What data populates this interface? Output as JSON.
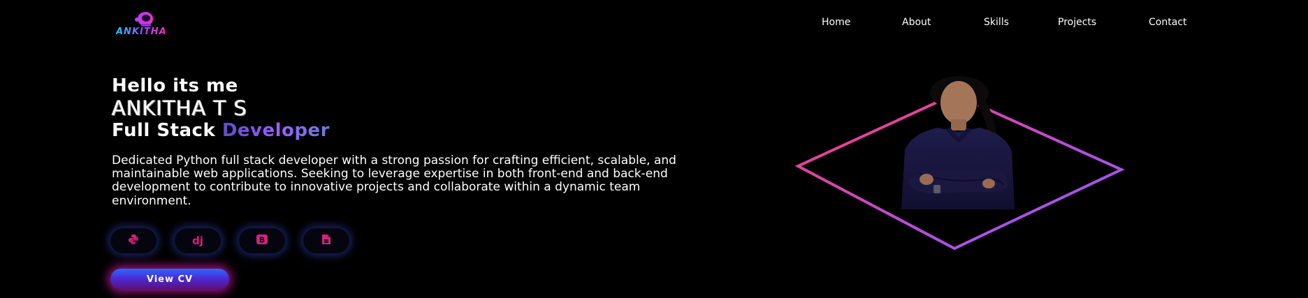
{
  "brand": {
    "name": "ANKITHA",
    "logo_icon": "astronaut-helmet-icon"
  },
  "nav": {
    "items": [
      "Home",
      "About",
      "Skills",
      "Projects",
      "Contact"
    ]
  },
  "hero": {
    "greeting": "Hello its me",
    "name": "ANKITHA T S",
    "role_prefix": "Full Stack",
    "role_accent": "Developer",
    "description": "Dedicated Python full stack developer with a strong passion for crafting efficient, scalable, and maintainable web applications. Seeking to leverage expertise in both front-end and back-end development to contribute to innovative projects and collaborate within a dynamic team environment."
  },
  "socials": [
    {
      "icon": "python-icon",
      "glyph": "◉"
    },
    {
      "icon": "django-icon",
      "glyph": "dj"
    },
    {
      "icon": "bootstrap-icon",
      "glyph": "B"
    },
    {
      "icon": "html-file-icon",
      "glyph": "▣"
    }
  ],
  "cta": {
    "label": "View CV"
  },
  "colors": {
    "background": "#000000",
    "accent_pink": "#ff3d6e",
    "accent_purple": "#8a5cff",
    "icon_color": "#d4237a"
  }
}
